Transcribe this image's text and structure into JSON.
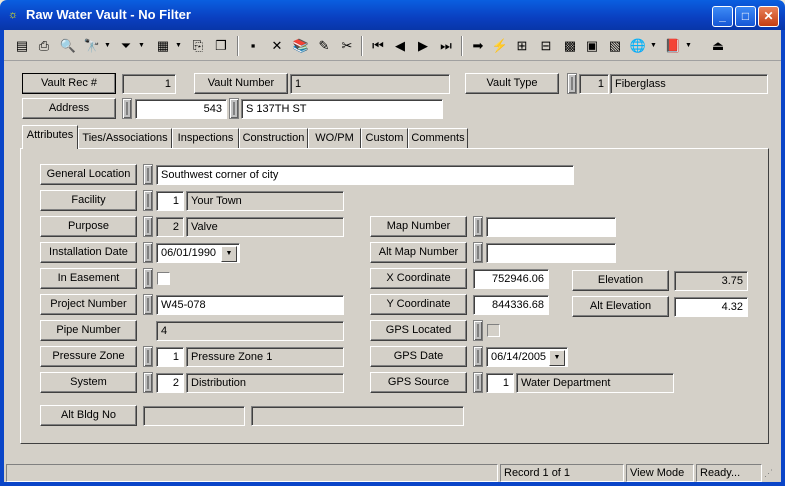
{
  "window": {
    "title": "Raw Water Vault - No Filter",
    "icon": "app-icon",
    "min": "_",
    "max": "□",
    "close": "✕"
  },
  "toolbar": [
    {
      "name": "save-icon",
      "glyph": "▤"
    },
    {
      "name": "print-icon",
      "glyph": "⎙"
    },
    {
      "name": "print-preview-icon",
      "glyph": "🔍"
    },
    {
      "name": "find-icon",
      "glyph": "🔭"
    },
    {
      "name": "filter-icon",
      "glyph": "⏷"
    },
    {
      "name": "report-icon",
      "glyph": "▦"
    },
    {
      "name": "copy-record-icon",
      "glyph": "⎘"
    },
    {
      "name": "duplicate-icon",
      "glyph": "❐"
    },
    {
      "name": "new-record-icon",
      "glyph": "▪"
    },
    {
      "name": "delete-icon",
      "glyph": "✕"
    },
    {
      "name": "books-icon",
      "glyph": "📚"
    },
    {
      "name": "edit-pencil-icon",
      "glyph": "✎"
    },
    {
      "name": "cut-icon",
      "glyph": "✂"
    },
    {
      "name": "first-record-icon",
      "glyph": "⏮"
    },
    {
      "name": "prev-record-icon",
      "glyph": "◀"
    },
    {
      "name": "next-record-icon",
      "glyph": "▶"
    },
    {
      "name": "last-record-icon",
      "glyph": "⏭"
    },
    {
      "name": "goto-icon",
      "glyph": "➡"
    },
    {
      "name": "lightning-icon",
      "glyph": "⚡"
    },
    {
      "name": "map-link-icon",
      "glyph": "⊞"
    },
    {
      "name": "tree-icon",
      "glyph": "⊟"
    },
    {
      "name": "map-icon",
      "glyph": "▩"
    },
    {
      "name": "calculator-icon",
      "glyph": "▣"
    },
    {
      "name": "gis-icon",
      "glyph": "▧"
    },
    {
      "name": "globe-icon",
      "glyph": "🌐"
    },
    {
      "name": "book-icon",
      "glyph": "📕"
    },
    {
      "name": "exit-icon",
      "glyph": "⏏"
    }
  ],
  "header": {
    "vault_rec_label": "Vault Rec #",
    "vault_rec_value": "1",
    "vault_number_label": "Vault Number",
    "vault_number_value": "1",
    "vault_type_label": "Vault Type",
    "vault_type_code": "1",
    "vault_type_value": "Fiberglass",
    "address_label": "Address",
    "address_number": "543",
    "address_street": "S 137TH ST"
  },
  "tabs": [
    {
      "label": "Attributes"
    },
    {
      "label": "Ties/Associations"
    },
    {
      "label": "Inspections"
    },
    {
      "label": "Construction"
    },
    {
      "label": "WO/PM"
    },
    {
      "label": "Custom"
    },
    {
      "label": "Comments"
    }
  ],
  "attributes": {
    "general_location_label": "General Location",
    "general_location_value": "Southwest corner of city",
    "facility_label": "Facility",
    "facility_code": "1",
    "facility_value": "Your Town",
    "purpose_label": "Purpose",
    "purpose_code": "2",
    "purpose_value": "Valve",
    "installation_date_label": "Installation Date",
    "installation_date_value": "06/01/1990",
    "in_easement_label": "In Easement",
    "project_number_label": "Project Number",
    "project_number_value": "W45-078",
    "pipe_number_label": "Pipe Number",
    "pipe_number_value": "4",
    "pressure_zone_label": "Pressure Zone",
    "pressure_zone_code": "1",
    "pressure_zone_value": "Pressure Zone 1",
    "system_label": "System",
    "system_code": "2",
    "system_value": "Distribution",
    "alt_bldg_label": "Alt Bldg No",
    "map_number_label": "Map Number",
    "map_number_value": "",
    "alt_map_number_label": "Alt Map Number",
    "alt_map_number_value": "",
    "x_coord_label": "X Coordinate",
    "x_coord_value": "752946.06",
    "y_coord_label": "Y Coordinate",
    "y_coord_value": "844336.68",
    "gps_located_label": "GPS Located",
    "gps_date_label": "GPS Date",
    "gps_date_value": "06/14/2005",
    "gps_source_label": "GPS Source",
    "gps_source_code": "1",
    "gps_source_value": "Water Department",
    "elevation_label": "Elevation",
    "elevation_value": "3.75",
    "alt_elevation_label": "Alt Elevation",
    "alt_elevation_value": "4.32"
  },
  "status": {
    "record": "Record 1 of 1",
    "mode": "View Mode",
    "state": "Ready..."
  }
}
